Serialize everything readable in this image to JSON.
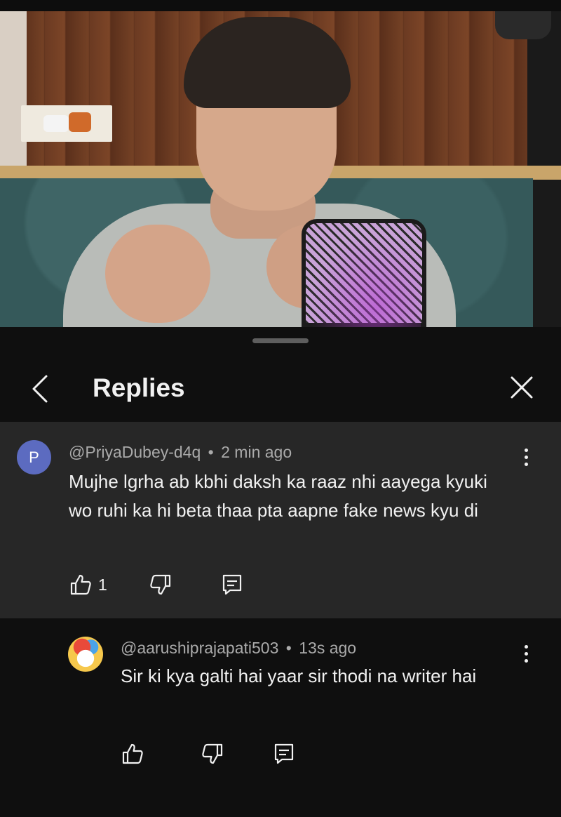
{
  "header": {
    "title": "Replies"
  },
  "parent_comment": {
    "avatar_letter": "P",
    "author": "@PriyaDubey-d4q",
    "time": "2 min ago",
    "text": "Mujhe lgrha ab kbhi daksh ka raaz nhi aayega kyuki wo ruhi ka hi beta thaa pta aapne fake news kyu di",
    "likes": "1"
  },
  "reply_comment": {
    "author": "@aarushiprajapati503",
    "time": "13s ago",
    "text": "Sir ki kya galti hai yaar sir thodi na writer hai"
  },
  "separator": "•",
  "icons": {
    "back": "chevron-left-icon",
    "close": "close-icon",
    "more": "more-vert-icon",
    "like": "thumbs-up-icon",
    "dislike": "thumbs-down-icon",
    "reply": "reply-icon"
  },
  "colors": {
    "panel_bg": "#0f0f0f",
    "parent_bg": "#272727",
    "avatar_p": "#5c6bc0",
    "meta_text": "#aaaaaa"
  }
}
